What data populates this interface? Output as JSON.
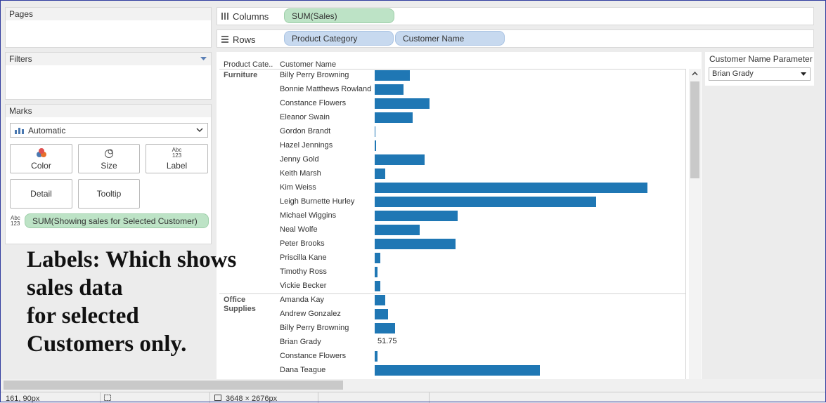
{
  "pages_card": {
    "title": "Pages"
  },
  "filters_card": {
    "title": "Filters"
  },
  "marks_card": {
    "title": "Marks",
    "mark_type": "Automatic",
    "buttons": {
      "color": "Color",
      "size": "Size",
      "label": "Label",
      "detail": "Detail",
      "tooltip": "Tooltip"
    },
    "label_icon_text": "Abc\n123",
    "label_pill": "SUM(Showing sales for Selected Customer)"
  },
  "shelves": {
    "columns_label": "Columns",
    "columns_pill": "SUM(Sales)",
    "rows_label": "Rows",
    "rows_pills": [
      "Product Category",
      "Customer Name"
    ]
  },
  "view": {
    "col_headers": [
      "Product Cate..",
      "Customer Name"
    ]
  },
  "parameter": {
    "title": "Customer Name Parameter",
    "value": "Brian Grady"
  },
  "annotation": {
    "lines": [
      "Labels: Which shows",
      "sales data",
      "for selected",
      "Customers only."
    ]
  },
  "status_bar": {
    "left": "161, 90px",
    "right": "3648 × 2676px"
  },
  "colors": {
    "bar": "#1f77b4",
    "green_pill": "#bde3c6",
    "blue_pill": "#c7d9ef"
  },
  "chart_data": {
    "type": "bar",
    "orientation": "horizontal",
    "groups": [
      {
        "category": "Furniture",
        "customers": [
          {
            "name": "Billy Perry Browning",
            "value": 50
          },
          {
            "name": "Bonnie Matthews Rowland",
            "value": 41
          },
          {
            "name": "Constance Flowers",
            "value": 78
          },
          {
            "name": "Eleanor Swain",
            "value": 54
          },
          {
            "name": "Gordon Brandt",
            "value": 1
          },
          {
            "name": "Hazel Jennings",
            "value": 2
          },
          {
            "name": "Jenny Gold",
            "value": 71
          },
          {
            "name": "Keith Marsh",
            "value": 15
          },
          {
            "name": "Kim Weiss",
            "value": 388
          },
          {
            "name": "Leigh Burnette Hurley",
            "value": 315
          },
          {
            "name": "Michael Wiggins",
            "value": 118
          },
          {
            "name": "Neal Wolfe",
            "value": 64
          },
          {
            "name": "Peter Brooks",
            "value": 115
          },
          {
            "name": "Priscilla Kane",
            "value": 8
          },
          {
            "name": "Timothy Ross",
            "value": 4
          },
          {
            "name": "Vickie Becker",
            "value": 8
          }
        ]
      },
      {
        "category": "Office Supplies",
        "customers": [
          {
            "name": "Amanda Kay",
            "value": 15
          },
          {
            "name": "Andrew Gonzalez",
            "value": 19
          },
          {
            "name": "Billy Perry Browning",
            "value": 29
          },
          {
            "name": "Brian Grady",
            "value": 0,
            "label": "51.75"
          },
          {
            "name": "Constance Flowers",
            "value": 4
          },
          {
            "name": "Dana Teague",
            "value": 235
          }
        ]
      }
    ],
    "xmax": 440,
    "grid": false
  }
}
